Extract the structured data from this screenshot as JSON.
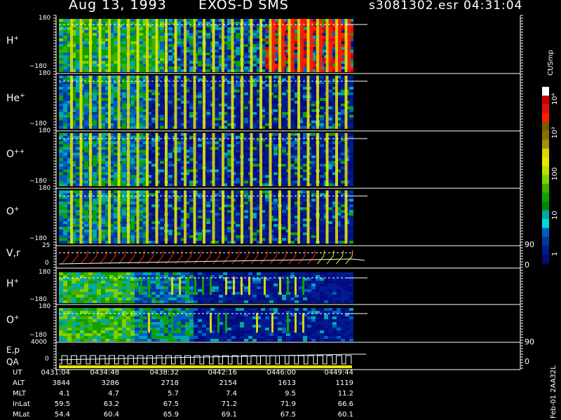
{
  "header": {
    "date": "Aug 13, 1993",
    "instrument": "EXOS-D SMS",
    "file": "s3081302.esr",
    "time": "04:31:04"
  },
  "panels": [
    {
      "label": "H",
      "charge": "+",
      "ymax": "180",
      "ymin": "−180",
      "style": "hot"
    },
    {
      "label": "He",
      "charge": "+",
      "ymax": "180",
      "ymin": "−180",
      "style": "mid"
    },
    {
      "label": "O",
      "charge": "++",
      "ymax": "180",
      "ymin": "−180",
      "style": "mid"
    },
    {
      "label": "O",
      "charge": "+",
      "ymax": "180",
      "ymin": "−180",
      "style": "mid"
    }
  ],
  "vr_panel": {
    "label": "V,r",
    "ymax": "25",
    "ymin": "0",
    "right_top": "90",
    "right_bottom": "0"
  },
  "lower_panels": [
    {
      "label": "H",
      "charge": "+",
      "ymax": "180",
      "ymin": "−180"
    },
    {
      "label": "O",
      "charge": "+",
      "ymax": "180",
      "ymin": "−180"
    }
  ],
  "ep_panel": {
    "label_top": "E,p",
    "label_bottom": "QA",
    "ymax": "4000",
    "ymin": "0",
    "right_top": "90",
    "right_bottom": "0"
  },
  "colorbar": {
    "unit": "Ct/Smp",
    "ticks": [
      "10⁴",
      "10³",
      "100",
      "10",
      "1"
    ],
    "colors": [
      "#ffffff",
      "#cc0000",
      "#e01010",
      "#ff2000",
      "#7a5a00",
      "#8a7000",
      "#a89000",
      "#d8d800",
      "#e8e800",
      "#b8e000",
      "#80d000",
      "#40b000",
      "#10a000",
      "#008800",
      "#00a8a8",
      "#00d8d8",
      "#0060c0",
      "#0038a0",
      "#001c90",
      "#000c80"
    ]
  },
  "footer_note": "Feb-01 2AA32L",
  "table": {
    "rows": [
      {
        "label": "UT",
        "values": [
          "0431:04",
          "0434:48",
          "0438:32",
          "0442:16",
          "0446:00",
          "0449:44"
        ]
      },
      {
        "label": "ALT",
        "values": [
          "3844",
          "3286",
          "2718",
          "2154",
          "1613",
          "1119"
        ]
      },
      {
        "label": "MLT",
        "values": [
          "4.1",
          "4.7",
          "5.7",
          "7.4",
          "9.5",
          "11.2"
        ]
      },
      {
        "label": "InLat",
        "values": [
          "59.5",
          "63.2",
          "67.5",
          "71.2",
          "71.9",
          "66.6"
        ]
      },
      {
        "label": "MLat",
        "values": [
          "54.4",
          "60.4",
          "65.9",
          "69.1",
          "67.5",
          "60.1"
        ]
      }
    ]
  },
  "chart_data": {
    "type": "heatmap",
    "title": "Aug 13, 1993   EXOS-D SMS",
    "x_ticks_ut": [
      "0431:04",
      "0434:48",
      "0438:32",
      "0442:16",
      "0446:00",
      "0449:44"
    ],
    "panels": [
      "H+",
      "He+",
      "O++",
      "O+",
      "V,r",
      "H+",
      "O+",
      "E,p"
    ],
    "y_ranges": {
      "pitch_angle": [
        -180,
        180
      ],
      "V,r": [
        0,
        25
      ],
      "E,p": [
        0,
        4000
      ]
    },
    "colorbar_label": "Ct/Smp",
    "colorbar_ticks": [
      "1",
      "10",
      "100",
      "10³",
      "10⁴"
    ]
  }
}
